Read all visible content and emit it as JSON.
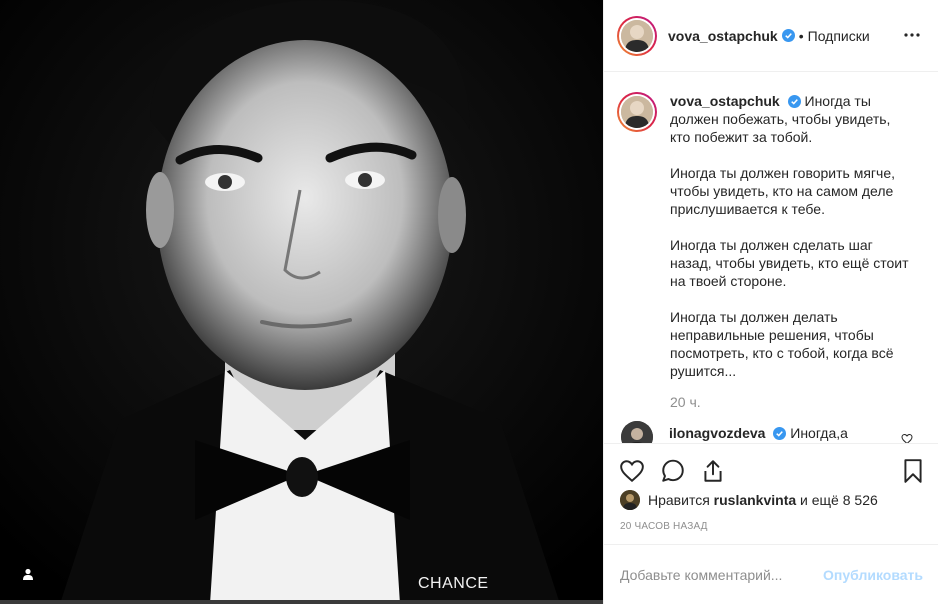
{
  "post": {
    "username": "vova_ostapchuk",
    "follow_label": "Подписки",
    "dot": "•",
    "photo_watermark": "CHANCE",
    "caption": {
      "username": "vova_ostapchuk",
      "paragraphs": [
        "Иногда ты должен побежать, чтобы увидеть, кто побежит за тобой.",
        "Иногда ты должен говорить мягче, чтобы увидеть, кто на самом деле прислушивается к тебе.",
        "Иногда ты должен сделать шаг назад, чтобы увидеть, кто ещё стоит на твоей стороне.",
        "Иногда ты должен делать неправильные решения, чтобы посмотреть, кто с тобой, когда всё рушится..."
      ],
      "time_ago": "20 ч."
    },
    "comment": {
      "username": "ilonagvozdeva",
      "text": "Иногда,а"
    },
    "likes": {
      "prefix": "Нравится",
      "user": "ruslankvinta",
      "suffix": "и ещё 8 526"
    },
    "posted_ago": "20 ЧАСОВ НАЗАД",
    "comment_input_placeholder": "Добавьте комментарий...",
    "publish_label": "Опубликовать"
  },
  "icons": [
    "more-icon",
    "verified-icon",
    "heart-icon",
    "comment-icon",
    "share-icon",
    "bookmark-icon",
    "user-tag-icon"
  ],
  "colors": {
    "verified": "#3897f0",
    "publish_disabled": "#b3dbff",
    "secondary_text": "#8e8e8e",
    "border": "#efefef"
  }
}
